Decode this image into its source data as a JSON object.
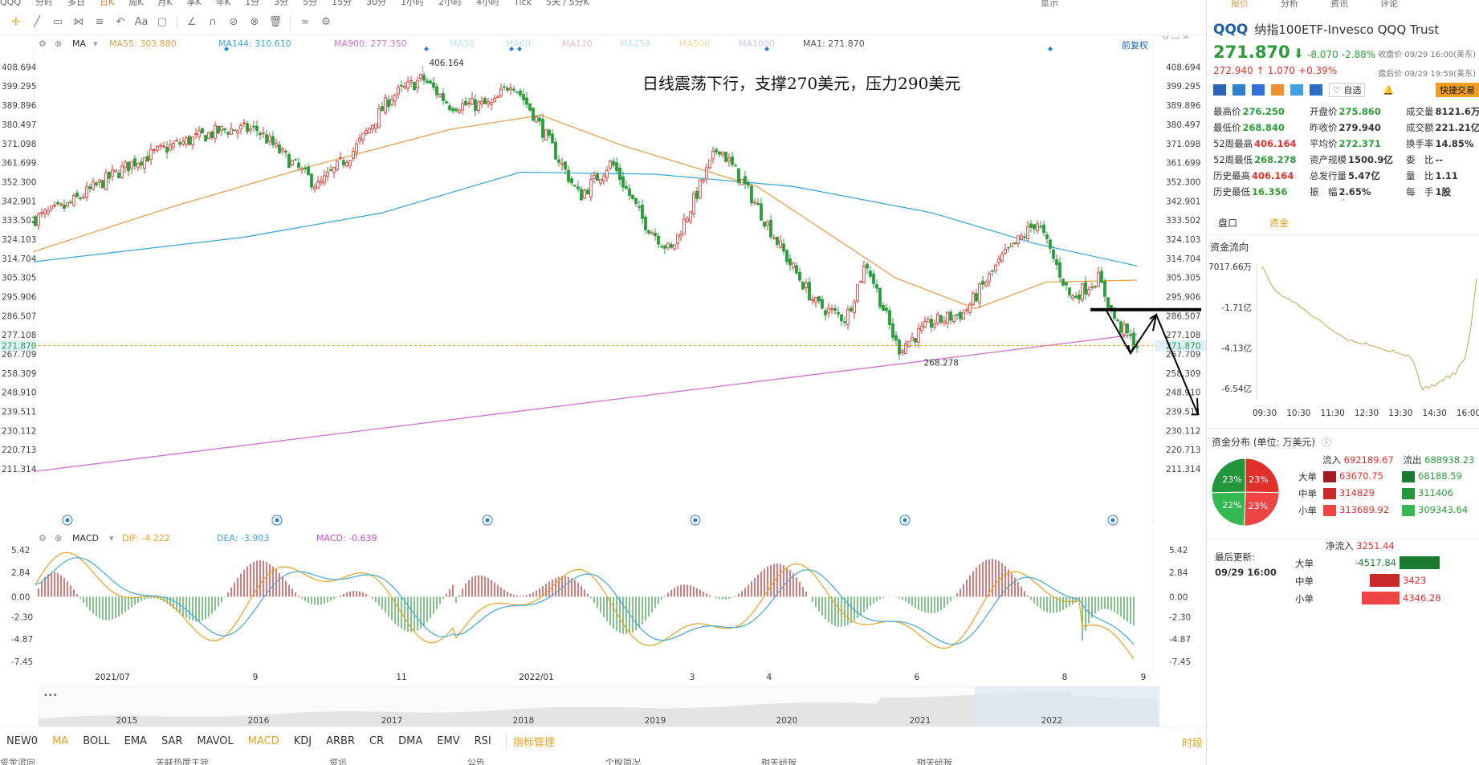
{
  "top_tabs": [
    "QQQ",
    "分时",
    "多日",
    "日K",
    "周K",
    "月K",
    "季K",
    "年K",
    "1分",
    "3分",
    "5分",
    "15分",
    "30分",
    "1小时",
    "2小时",
    "4小时",
    "Tick",
    "5天 / 5分K"
  ],
  "active_top_tab": "日K",
  "top_right": {
    "display_label": "显示"
  },
  "main_legend": {
    "ma_label": "MA",
    "ma55": "MA55: 303.880",
    "ma144": "MA144: 310.610",
    "ma900": "MA900: 277.350",
    "ma30": "MA30",
    "ma60": "MA60",
    "ma120": "MA120",
    "ma250": "MA250",
    "ma500": "MA500",
    "ma1000": "MA1000",
    "ma1": "MA1: 271.870",
    "fuquan": "前复权"
  },
  "macd_legend": {
    "label": "MACD",
    "dif": "DIF: -4.222",
    "dea": "DEA: -3.903",
    "macd": "MACD: -0.639"
  },
  "annotation": "日线震荡下行，支撑270美元，压力290美元",
  "bottom_indicators": [
    "NEW0",
    "MA",
    "BOLL",
    "EMA",
    "SAR",
    "MAVOL",
    "MACD",
    "KDJ",
    "ARBR",
    "CR",
    "DMA",
    "EMV",
    "RSI"
  ],
  "indicator_manage": "指标管理",
  "timeshare_label": "时段",
  "footer_tabs": [
    "资金流向",
    "关联热度主导",
    "资讯",
    "公告",
    "个股简况",
    "相关研报",
    "相关研报"
  ],
  "colors": {
    "up": "#e0302a",
    "down": "#2a9d3a",
    "ma55": "#e8a04a",
    "ma144": "#40a8d8",
    "ma900": "#d070d0",
    "dif": "#e8a020",
    "dea": "#40a8d8",
    "accent": "#e8a020"
  },
  "right_panel": {
    "tabs": [
      "报价",
      "分析",
      "资讯",
      "评论"
    ],
    "symbol": "QQQ",
    "name": "纳指100ETF-Invesco QQQ Trust",
    "price": "271.870",
    "price_arrow": "⬇",
    "change": "-8.070",
    "change_pct": "-2.88%",
    "close_label": "收盘价 09/29 16:00(美东)",
    "ah_price": "272.940",
    "ah_arrow": "↑",
    "ah_change": "1.070",
    "ah_pct": "+0.39%",
    "ah_label": "盘后价 09/29 19:59(美东)",
    "watch_label": "自选",
    "quick_trade": "快捷交易",
    "stats": [
      {
        "k": "最高价",
        "v": "276.250",
        "c": "green"
      },
      {
        "k": "开盘价",
        "v": "275.860",
        "c": "green"
      },
      {
        "k": "成交量",
        "v": "8121.6万",
        "c": ""
      },
      {
        "k": "最低价",
        "v": "268.840",
        "c": "green"
      },
      {
        "k": "昨收价",
        "v": "279.940",
        "c": ""
      },
      {
        "k": "成交额",
        "v": "221.21亿",
        "c": ""
      },
      {
        "k": "52周最高",
        "v": "406.164",
        "c": "red"
      },
      {
        "k": "平均价",
        "v": "272.371",
        "c": "green"
      },
      {
        "k": "换手率",
        "v": "14.85%",
        "c": ""
      },
      {
        "k": "52周最低",
        "v": "268.278",
        "c": "green"
      },
      {
        "k": "资产规模",
        "v": "1500.9亿",
        "c": ""
      },
      {
        "k": "委　比",
        "v": "--",
        "c": ""
      },
      {
        "k": "历史最高",
        "v": "406.164",
        "c": "red"
      },
      {
        "k": "总发行量",
        "v": "5.47亿",
        "c": ""
      },
      {
        "k": "量　比",
        "v": "1.11",
        "c": ""
      },
      {
        "k": "历史最低",
        "v": "16.356",
        "c": "green"
      },
      {
        "k": "振　幅",
        "v": "2.65%",
        "c": ""
      },
      {
        "k": "每　手",
        "v": "1股",
        "c": ""
      }
    ],
    "flow_tabs": [
      "盘口",
      "资金"
    ],
    "flow_title": "资金流向",
    "flow_y_labels": [
      "7017.66万",
      "-1.71亿",
      "-4.13亿",
      "-6.54亿"
    ],
    "flow_x_labels": [
      "09:30",
      "10:30",
      "11:30",
      "12:30",
      "13:30",
      "14:30",
      "16:00"
    ],
    "flow_series": [
      7017.66,
      5200,
      1000,
      -3000,
      -5500,
      -7800,
      -9000,
      -10500,
      -11500,
      -12000,
      -13500,
      -14000,
      -15000,
      -17000,
      -18000,
      -19500,
      -21000,
      -22500,
      -23500,
      -24000,
      -25500,
      -27000,
      -28500,
      -30000,
      -31000,
      -32500,
      -33000,
      -34500,
      -35500,
      -37000,
      -36500,
      -37500,
      -38000,
      -38500,
      -39000,
      -38000,
      -39500,
      -40000,
      -40500,
      -41000,
      -41500,
      -42500,
      -43000,
      -43500,
      -42500,
      -44000,
      -44500,
      -45000,
      -46000,
      -45500,
      -47000,
      -50000,
      -55000,
      -62000,
      -66000,
      -64000,
      -65000,
      -63000,
      -64000,
      -62000,
      -61000,
      -60000,
      -58000,
      -59000,
      -56000,
      -57000,
      -52000,
      -50000,
      -48000,
      -40000,
      -30000,
      -15000,
      0
    ],
    "dist_title": "资金分布 (单位: 万美元)",
    "inflow_label": "流入",
    "inflow_total": "692189.67",
    "outflow_label": "流出",
    "outflow_total": "688938.23",
    "dist_rows": [
      {
        "label": "大单",
        "in": "63670.75",
        "out": "68188.59",
        "in_color": "#a01c22",
        "out_color": "#1a7a30"
      },
      {
        "label": "中单",
        "in": "314829",
        "out": "311406",
        "in_color": "#c82a2a",
        "out_color": "#22963a"
      },
      {
        "label": "小单",
        "in": "313689.92",
        "out": "309343.64",
        "in_color": "#ee4444",
        "out_color": "#34b850"
      }
    ],
    "pie_slices": [
      {
        "pct": "23%",
        "value": 23,
        "color": "#e0302a"
      },
      {
        "pct": "23%",
        "value": 23,
        "color": "#ee4444"
      },
      {
        "pct": "22%",
        "value": 22,
        "color": "#34b850"
      },
      {
        "pct": "23%",
        "value": 23,
        "color": "#22963a"
      }
    ],
    "last_update_label": "最后更新:",
    "last_update": "09/29 16:00",
    "net_label": "净流入",
    "net_value": "3251.44",
    "net_rows": [
      {
        "label": "大单",
        "value": "-4517.84",
        "color": "#1a7a30",
        "frac": -0.45
      },
      {
        "label": "中单",
        "value": "3423",
        "color": "#c82a2a",
        "frac": 0.34
      },
      {
        "label": "小单",
        "value": "4346.28",
        "color": "#ee4444",
        "frac": 0.43
      }
    ]
  },
  "chart_data": [
    {
      "type": "candlestick",
      "title": "",
      "y_ticks": [
        408.694,
        399.295,
        389.896,
        380.497,
        371.098,
        361.699,
        352.3,
        342.901,
        333.502,
        324.103,
        314.704,
        305.305,
        295.906,
        286.507,
        277.108,
        267.709,
        258.309,
        248.91,
        239.511,
        230.112,
        220.713,
        211.314
      ],
      "ylim": [
        207,
        412
      ],
      "x_labels": [
        "2021/07",
        "9",
        "11",
        "2022/01",
        "3",
        "4",
        "6",
        "8",
        "9"
      ],
      "current_price": 271.87,
      "high_label": "406.164",
      "low_label": "268.278",
      "close_path": [
        [
          "2021-06-01",
          334
        ],
        [
          "2021-06-15",
          340
        ],
        [
          "2021-07-01",
          352
        ],
        [
          "2021-07-15",
          362
        ],
        [
          "2021-08-01",
          370
        ],
        [
          "2021-08-15",
          375
        ],
        [
          "2021-08-25",
          378
        ],
        [
          "2021-09-07",
          378
        ],
        [
          "2021-09-20",
          364
        ],
        [
          "2021-10-04",
          350
        ],
        [
          "2021-10-20",
          368
        ],
        [
          "2021-11-05",
          394
        ],
        [
          "2021-11-19",
          403
        ],
        [
          "2021-12-01",
          390
        ],
        [
          "2021-12-20",
          390
        ],
        [
          "2021-12-28",
          402
        ],
        [
          "2022-01-07",
          385
        ],
        [
          "2022-01-27",
          345
        ],
        [
          "2022-02-10",
          362
        ],
        [
          "2022-02-24",
          333
        ],
        [
          "2022-03-08",
          318
        ],
        [
          "2022-03-29",
          370
        ],
        [
          "2022-04-12",
          346
        ],
        [
          "2022-04-29",
          313
        ],
        [
          "2022-05-11",
          292
        ],
        [
          "2022-05-24",
          285
        ],
        [
          "2022-06-02",
          313
        ],
        [
          "2022-06-16",
          270
        ],
        [
          "2022-07-01",
          283
        ],
        [
          "2022-07-15",
          288
        ],
        [
          "2022-08-01",
          315
        ],
        [
          "2022-08-16",
          333
        ],
        [
          "2022-08-31",
          295
        ],
        [
          "2022-09-12",
          305
        ],
        [
          "2022-09-20",
          283
        ],
        [
          "2022-09-29",
          272
        ]
      ],
      "ma55": [
        [
          "2021-06-01",
          318
        ],
        [
          "2021-08-01",
          340
        ],
        [
          "2021-10-01",
          360
        ],
        [
          "2021-12-01",
          378
        ],
        [
          "2022-01-10",
          385
        ],
        [
          "2022-02-15",
          370
        ],
        [
          "2022-04-15",
          350
        ],
        [
          "2022-06-15",
          305
        ],
        [
          "2022-07-20",
          290
        ],
        [
          "2022-08-20",
          303
        ],
        [
          "2022-09-29",
          304
        ]
      ],
      "ma144": [
        [
          "2021-06-01",
          313
        ],
        [
          "2021-09-01",
          325
        ],
        [
          "2021-11-01",
          337
        ],
        [
          "2022-01-01",
          357
        ],
        [
          "2022-03-01",
          356
        ],
        [
          "2022-05-01",
          350
        ],
        [
          "2022-07-01",
          337
        ],
        [
          "2022-08-15",
          322
        ],
        [
          "2022-09-29",
          311
        ]
      ],
      "ma900": [
        [
          "2021-06-01",
          210
        ],
        [
          "2022-09-29",
          277.35
        ]
      ],
      "series": [
        {
          "name": "MA55",
          "value": 303.88
        },
        {
          "name": "MA144",
          "value": 310.61
        },
        {
          "name": "MA900",
          "value": 277.35
        },
        {
          "name": "MA1",
          "value": 271.87
        }
      ]
    },
    {
      "type": "macd",
      "title": "",
      "y_ticks": [
        5.42,
        2.84,
        0.0,
        -2.3,
        -4.87,
        -7.45
      ],
      "ylim": [
        -8.2,
        6.8
      ],
      "series": [
        {
          "name": "DIF",
          "value": -4.222
        },
        {
          "name": "DEA",
          "value": -3.903
        },
        {
          "name": "MACD",
          "value": -0.639
        }
      ]
    }
  ],
  "overview": {
    "years": [
      "2015",
      "2016",
      "2017",
      "2018",
      "2019",
      "2020",
      "2021",
      "2022"
    ]
  }
}
